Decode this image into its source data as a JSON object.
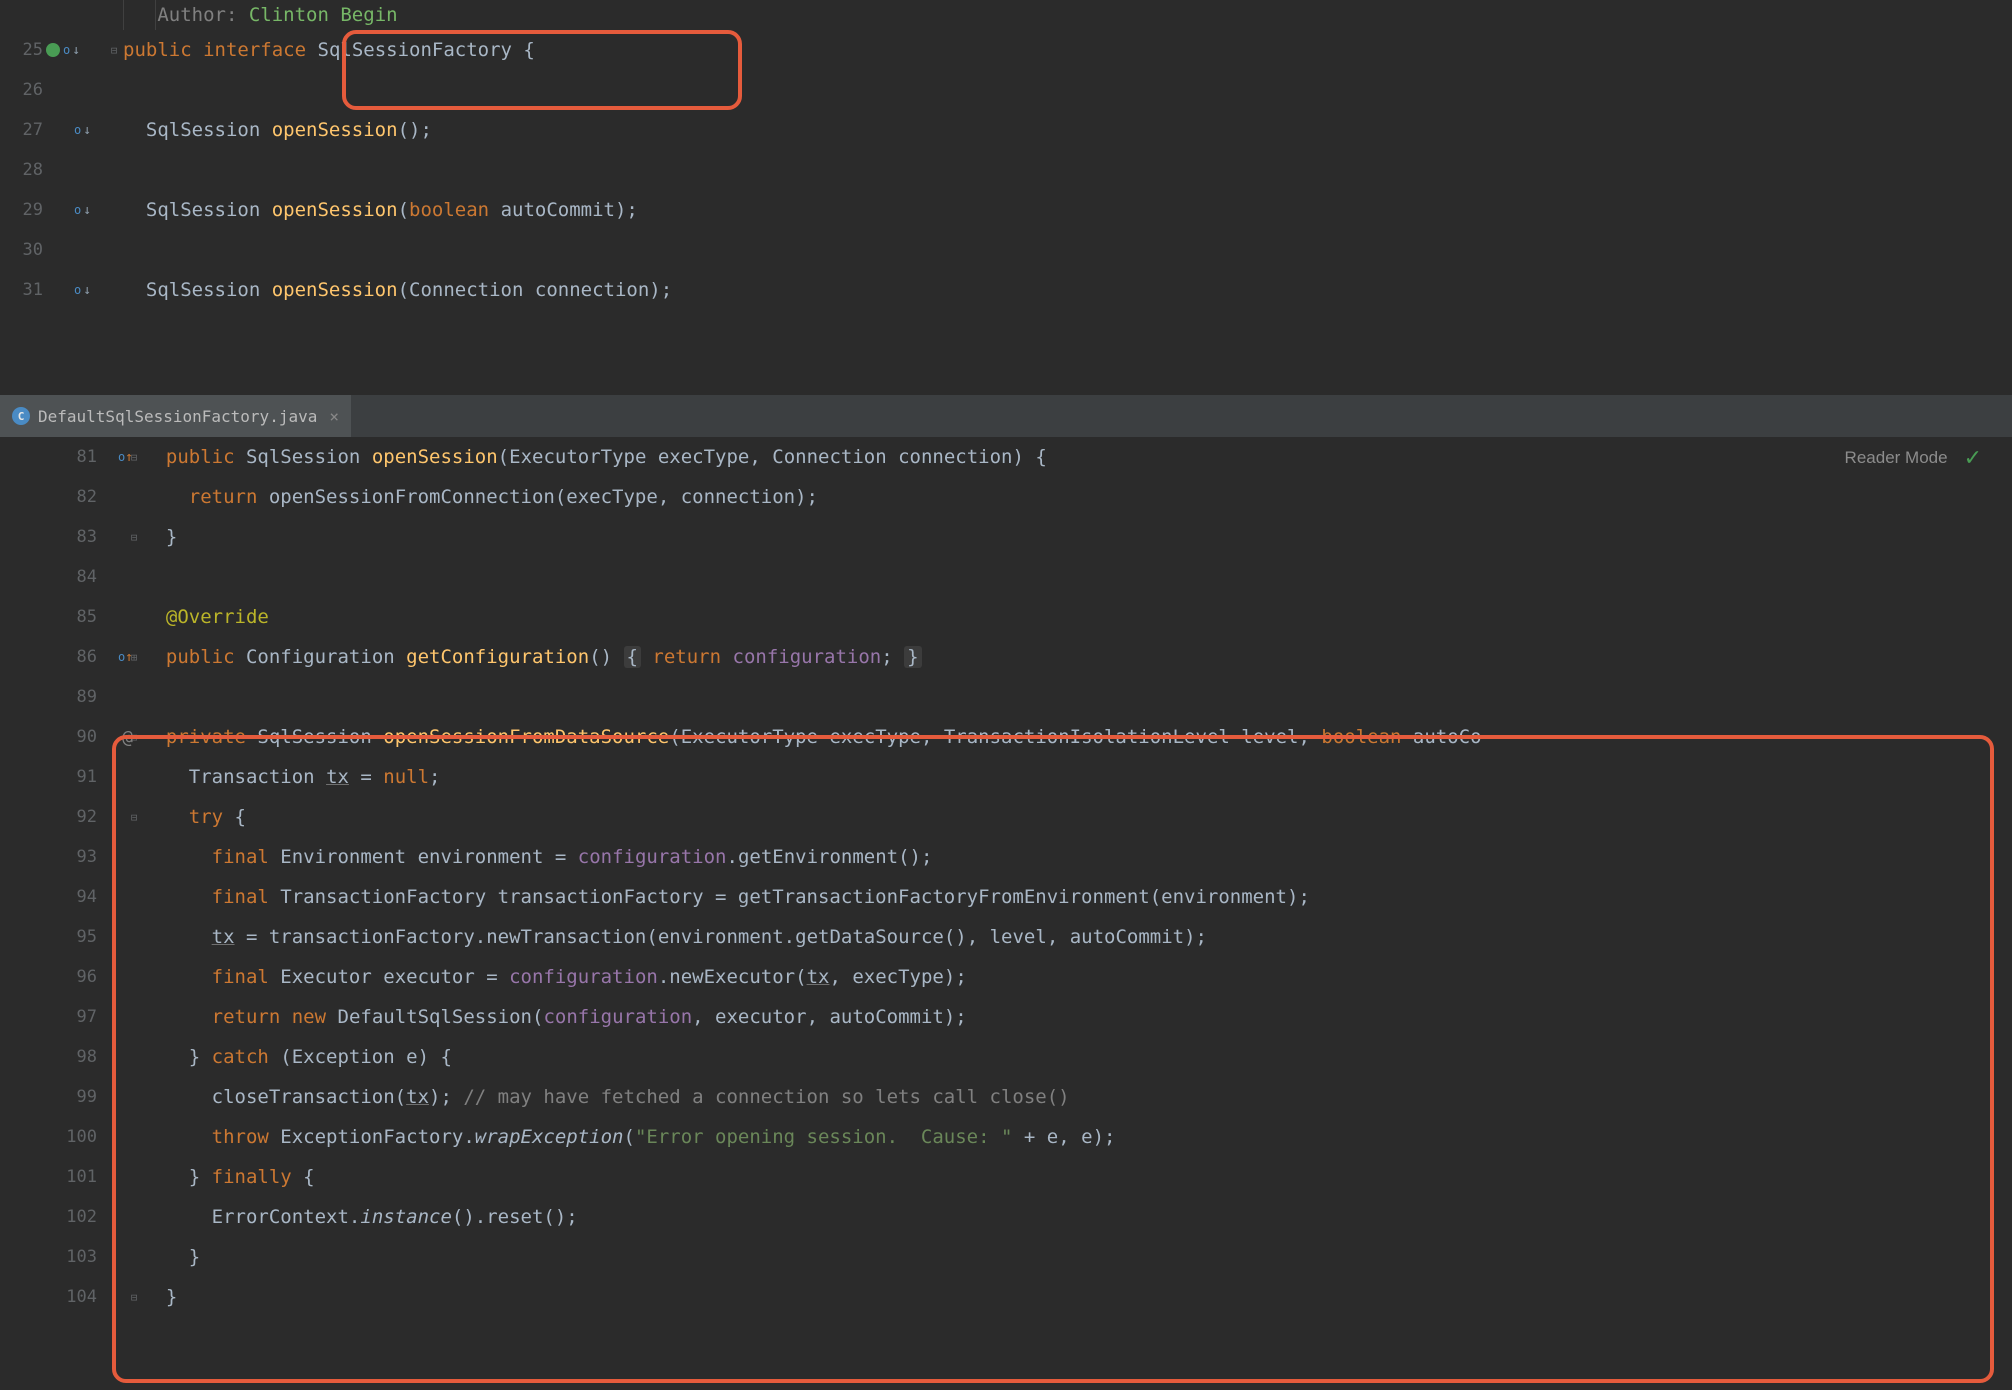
{
  "top_pane": {
    "author_label": "Author:",
    "author_name": "Clinton Begin",
    "lines": [
      {
        "num": "25",
        "icons": "green-override-down"
      },
      {
        "num": "26"
      },
      {
        "num": "27",
        "icons": "override-down"
      },
      {
        "num": "28"
      },
      {
        "num": "29",
        "icons": "override-down"
      },
      {
        "num": "30"
      },
      {
        "num": "31",
        "icons": "override-down"
      }
    ],
    "kw_public": "public",
    "kw_interface": "interface",
    "class_name": "SqlSessionFactory",
    "brace_open": "{",
    "ret_type": "SqlSession",
    "method1": "openSession",
    "method2": "openSession",
    "method3": "openSession",
    "kw_boolean": "boolean",
    "p_autocommit": "autoCommit",
    "p_connection_type": "Connection",
    "p_connection": "connection",
    "empty_parens": "()",
    "semicolon": ";"
  },
  "tab": {
    "name": "DefaultSqlSessionFactory.java",
    "icon_letter": "C"
  },
  "reader_mode_label": "Reader Mode",
  "bottom_pane": {
    "lines": {
      "l81": "81",
      "l82": "82",
      "l83": "83",
      "l84": "84",
      "l85": "85",
      "l86": "86",
      "l89": "89",
      "l90": "90",
      "l91": "91",
      "l92": "92",
      "l93": "93",
      "l94": "94",
      "l95": "95",
      "l96": "96",
      "l97": "97",
      "l98": "98",
      "l99": "99",
      "l100": "100",
      "l101": "101",
      "l102": "102",
      "l103": "103",
      "l104": "104"
    },
    "kw_public": "public",
    "kw_return": "return",
    "kw_private": "private",
    "kw_final": "final",
    "kw_try": "try",
    "kw_catch": "catch",
    "kw_throw": "throw",
    "kw_finally": "finally",
    "kw_new": "new",
    "kw_null": "null",
    "kw_boolean": "boolean",
    "ann_override": "@Override",
    "t_sqlsession": "SqlSession",
    "t_configuration": "Configuration",
    "t_executortype": "ExecutorType",
    "t_connection": "Connection",
    "t_transaction": "Transaction",
    "t_environment": "Environment",
    "t_transactionfactory": "TransactionFactory",
    "t_executor": "Executor",
    "t_exception": "Exception",
    "t_til": "TransactionIsolationLevel",
    "m_opensession": "openSession",
    "m_getconfiguration": "getConfiguration",
    "m_opensessionfromdatasource": "openSessionFromDataSource",
    "m_opensessionfromconnection": "openSessionFromConnection",
    "m_getenvironment": "getEnvironment",
    "m_gettxfactory": "getTransactionFactoryFromEnvironment",
    "m_newtransaction": "newTransaction",
    "m_getdatasource": "getDataSource",
    "m_newexecutor": "newExecutor",
    "m_closetransaction": "closeTransaction",
    "m_wrapexception": "wrapException",
    "m_instance": "instance",
    "m_reset": "reset",
    "cls_defaultsqlsession": "DefaultSqlSession",
    "cls_exceptionfactory": "ExceptionFactory",
    "cls_errorcontext": "ErrorContext",
    "f_configuration": "configuration",
    "v_exectype": "execType",
    "v_connection": "connection",
    "v_level": "level",
    "v_autocommit": "autoCommit",
    "v_tx": "tx",
    "v_environment": "environment",
    "v_transactionfactory": "transactionFactory",
    "v_executor": "executor",
    "v_e": "e",
    "v_autoco_trunc": "autoCo",
    "str_error": "\"Error opening session.  Cause: \"",
    "cmt_close": "// may have fetched a connection so lets call close()"
  }
}
